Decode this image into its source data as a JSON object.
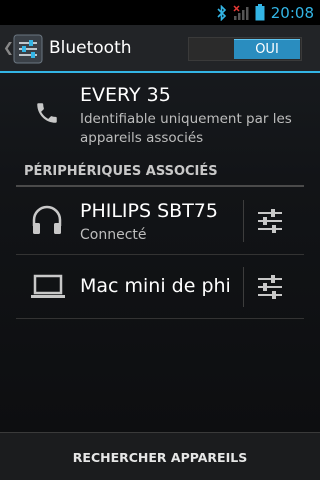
{
  "statusbar": {
    "time": "20:08",
    "icons": [
      "bluetooth-icon",
      "signal-no-service-icon",
      "battery-icon"
    ]
  },
  "actionbar": {
    "title": "Bluetooth",
    "toggle_label": "OUI"
  },
  "device": {
    "name": "EVERY 35",
    "description": "Identifiable uniquement par les appareils associés"
  },
  "paired_section": {
    "header": "PÉRIPHÉRIQUES ASSOCIÉS",
    "items": [
      {
        "name": "PHILIPS SBT75",
        "status": "Connecté",
        "icon": "headphones-icon"
      },
      {
        "name": "Mac mini de phil",
        "status": "",
        "icon": "laptop-icon"
      }
    ]
  },
  "bottom": {
    "button_label": "RECHERCHER APPAREILS"
  },
  "colors": {
    "accent": "#33b5e5",
    "toggle_on": "#2a8dbf"
  }
}
